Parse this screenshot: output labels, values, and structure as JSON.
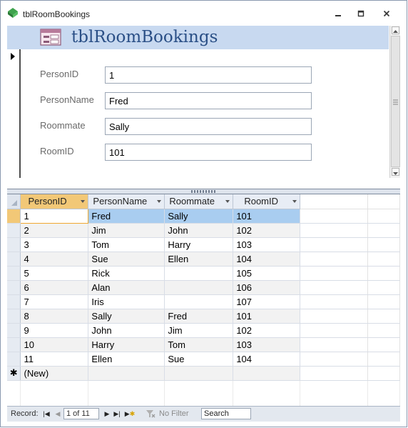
{
  "window": {
    "title": "tblRoomBookings"
  },
  "form": {
    "title": "tblRoomBookings",
    "fields": [
      {
        "label": "PersonID",
        "value": "1"
      },
      {
        "label": "PersonName",
        "value": "Fred"
      },
      {
        "label": "Roommate",
        "value": "Sally"
      },
      {
        "label": "RoomID",
        "value": "101"
      }
    ]
  },
  "datasheet": {
    "columns": [
      "PersonID",
      "PersonName",
      "Roommate",
      "RoomID"
    ],
    "rows": [
      [
        "1",
        "Fred",
        "Sally",
        "101"
      ],
      [
        "2",
        "Jim",
        "John",
        "102"
      ],
      [
        "3",
        "Tom",
        "Harry",
        "103"
      ],
      [
        "4",
        "Sue",
        "Ellen",
        "104"
      ],
      [
        "5",
        "Rick",
        "",
        "105"
      ],
      [
        "6",
        "Alan",
        "",
        "106"
      ],
      [
        "7",
        "Iris",
        "",
        "107"
      ],
      [
        "8",
        "Sally",
        "Fred",
        "101"
      ],
      [
        "9",
        "John",
        "Jim",
        "102"
      ],
      [
        "10",
        "Harry",
        "Tom",
        "103"
      ],
      [
        "11",
        "Ellen",
        "Sue",
        "104"
      ]
    ],
    "new_row_label": "(New)",
    "new_row_marker": "✱"
  },
  "navigation": {
    "record_label": "Record:",
    "position": "1 of 11",
    "no_filter_label": "No Filter",
    "search_label": "Search"
  },
  "colors": {
    "header_band": "#c8d9f0",
    "title_color": "#2a4f86",
    "current_row": "#a9cdf0",
    "selected_header": "#f2c877"
  },
  "icons": [
    "access-app-icon",
    "minimize-icon",
    "restore-icon",
    "close-icon",
    "form-icon",
    "record-pointer-icon",
    "first-record-icon",
    "previous-record-icon",
    "next-record-icon",
    "last-record-icon",
    "new-record-icon",
    "filter-icon"
  ]
}
